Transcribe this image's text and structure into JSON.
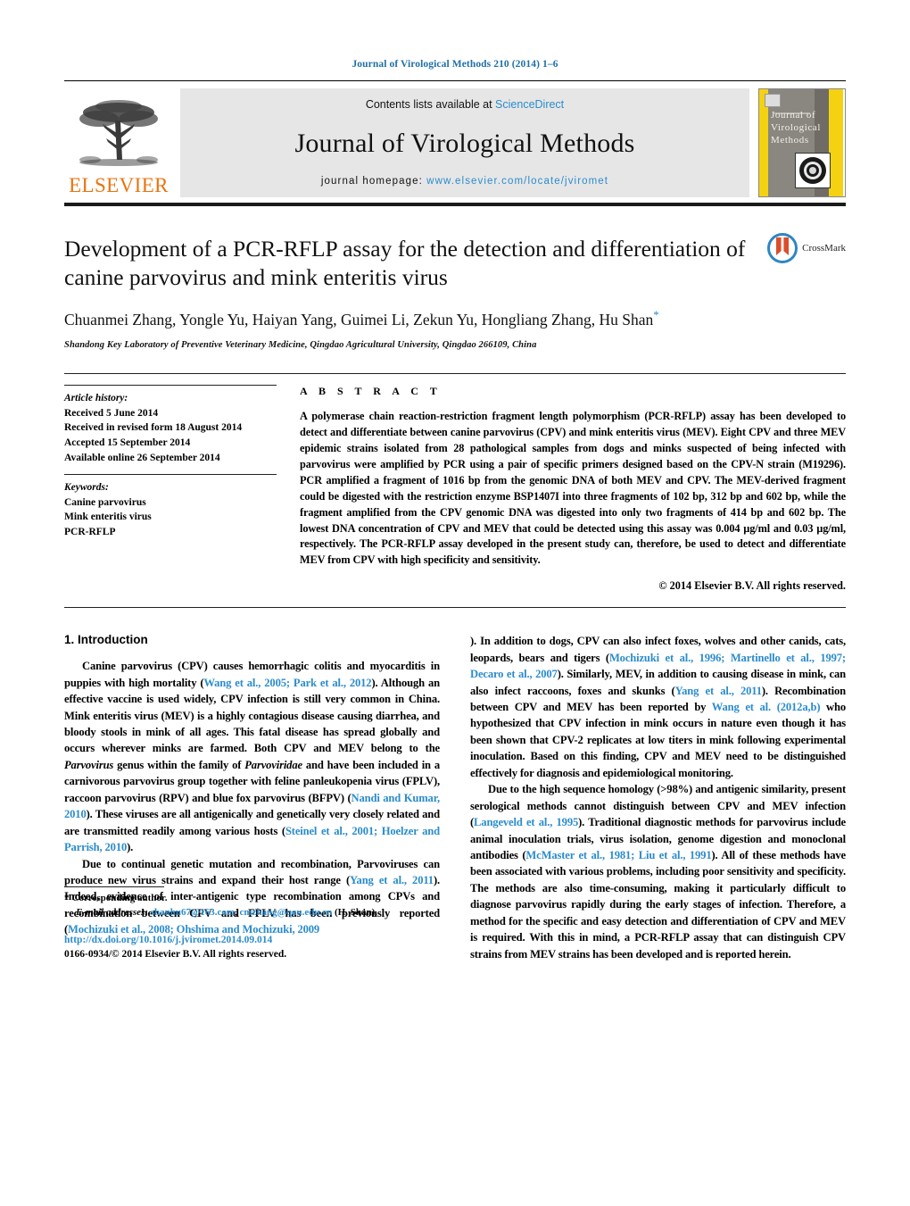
{
  "running_head": "Journal of Virological Methods 210 (2014) 1–6",
  "masthead": {
    "publisher": "ELSEVIER",
    "contents_prefix": "Contents lists available at ",
    "contents_link": "ScienceDirect",
    "journal_name": "Journal of Virological Methods",
    "homepage_prefix": "journal homepage: ",
    "homepage_url": "www.elsevier.com/locate/jviromet",
    "cover_title": "Journal of Virological Methods",
    "colors": {
      "elsevier_orange": "#E87511",
      "link_blue": "#2b8ccc",
      "banner_gray": "#e6e6e6",
      "cover_yellow": "#f5d211",
      "cover_gray": "#8a8780"
    }
  },
  "article": {
    "title": "Development of a PCR-RFLP assay for the detection and differentiation of canine parvovirus and mink enteritis virus",
    "authors": "Chuanmei Zhang, Yongle Yu, Haiyan Yang, Guimei Li, Zekun Yu, Hongliang Zhang, Hu Shan",
    "affiliation": "Shandong Key Laboratory of Preventive Veterinary Medicine, Qingdao Agricultural University, Qingdao 266109, China",
    "crossmark_label": "CrossMark"
  },
  "info": {
    "history_label": "Article history:",
    "history": [
      "Received 5 June 2014",
      "Received in revised form 18 August 2014",
      "Accepted 15 September 2014",
      "Available online 26 September 2014"
    ],
    "keywords_label": "Keywords:",
    "keywords": [
      "Canine parvovirus",
      "Mink enteritis virus",
      "PCR-RFLP"
    ]
  },
  "abstract": {
    "heading": "A B S T R A C T",
    "text": "A polymerase chain reaction-restriction fragment length polymorphism (PCR-RFLP) assay has been developed to detect and differentiate between canine parvovirus (CPV) and mink enteritis virus (MEV). Eight CPV and three MEV epidemic strains isolated from 28 pathological samples from dogs and minks suspected of being infected with parvovirus were amplified by PCR using a pair of specific primers designed based on the CPV-N strain (M19296). PCR amplified a fragment of 1016 bp from the genomic DNA of both MEV and CPV. The MEV-derived fragment could be digested with the restriction enzyme BSP1407I into three fragments of 102 bp, 312 bp and 602 bp, while the fragment amplified from the CPV genomic DNA was digested into only two fragments of 414 bp and 602 bp. The lowest DNA concentration of CPV and MEV that could be detected using this assay was 0.004 µg/ml and 0.03 µg/ml, respectively. The PCR-RFLP assay developed in the present study can, therefore, be used to detect and differentiate MEV from CPV with high specificity and sensitivity.",
    "copyright": "© 2014 Elsevier B.V. All rights reserved."
  },
  "introduction": {
    "heading": "1. Introduction",
    "left_p1_a": "Canine parvovirus (CPV) causes hemorrhagic colitis and myocarditis in puppies with high mortality (",
    "left_p1_cite1": "Wang et al., 2005; Park et al., 2012",
    "left_p1_b": "). Although an effective vaccine is used widely, CPV infection is still very common in China. Mink enteritis virus (MEV) is a highly contagious disease causing diarrhea, and bloody stools in mink of all ages. This fatal disease has spread globally and occurs wherever minks are farmed. Both CPV and MEV belong to the ",
    "left_p1_it1": "Parvovirus",
    "left_p1_c": " genus within the family of ",
    "left_p1_it2": "Parvoviridae",
    "left_p1_d": " and have been included in a carnivorous parvovirus group together with feline panleukopenia virus (FPLV), raccoon parvovirus (RPV) and blue fox parvovirus (BFPV) (",
    "left_p1_cite2": "Nandi and Kumar, 2010",
    "left_p1_e": "). These viruses are all antigenically and genetically very closely related and are transmitted readily among various hosts (",
    "left_p1_cite3": "Steinel et al., 2001; Hoelzer and Parrish, 2010",
    "left_p1_f": ").",
    "left_p2_a": "Due to continual genetic mutation and recombination, Parvoviruses can produce new virus strains and expand their host range (",
    "left_p2_cite1": "Yang et al., 2011",
    "left_p2_b": "). Indeed, evidence of inter-antigenic type recombination among CPVs and recombination between CPV and FPLV has been previously reported (",
    "left_p2_cite2": "Mochizuki et al., 2008; Ohshima and Mochizuki, 2009",
    "left_p2_c": "). In addition to dogs, CPV can also infect foxes, wolves and other canids, cats, leopards, bears and tigers (",
    "right_p1_cite1": "Mochizuki et al., 1996; Martinello et al., 1997; Decaro et al., 2007",
    "right_p1_a": "). Similarly, MEV, in addition to causing disease in mink, can also infect raccoons, foxes and skunks (",
    "right_p1_cite2": "Yang et al., 2011",
    "right_p1_b": "). Recombination between CPV and MEV has been reported by ",
    "right_p1_cite3": "Wang et al. (2012a,b)",
    "right_p1_c": " who hypothesized that CPV infection in mink occurs in nature even though it has been shown that CPV-2 replicates at low titers in mink following experimental inoculation. Based on this finding, CPV and MEV need to be distinguished effectively for diagnosis and epidemiological monitoring.",
    "right_p2_a": "Due to the high sequence homology (>98%) and antigenic similarity, present serological methods cannot distinguish between CPV and MEV infection (",
    "right_p2_cite1": "Langeveld et al., 1995",
    "right_p2_b": "). Traditional diagnostic methods for parvovirus include animal inoculation trials, virus isolation, genome digestion and monoclonal antibodies (",
    "right_p2_cite2": "McMaster et al., 1981; Liu et al., 1991",
    "right_p2_c": "). All of these methods have been associated with various problems, including poor sensitivity and specificity. The methods are also time-consuming, making it particularly difficult to diagnose parvovirus rapidly during the early stages of infection. Therefore, a method for the specific and easy detection and differentiation of CPV and MEV is required. With this in mind, a PCR-RFLP assay that can distinguish CPV strains from MEV strains has been developed and is reported herein."
  },
  "footer": {
    "corresponding_star": "*",
    "corresponding_label": "Corresponding author.",
    "email_label": "E-mail addresses:",
    "email1": "shanhu67@163.com",
    "email_sep": ", ",
    "email2": "cmzhang@qau.edu.cn",
    "email_suffix": " (H. Shan).",
    "doi": "http://dx.doi.org/10.1016/j.jviromet.2014.09.014",
    "issn_line": "0166-0934/© 2014 Elsevier B.V. All rights reserved."
  }
}
